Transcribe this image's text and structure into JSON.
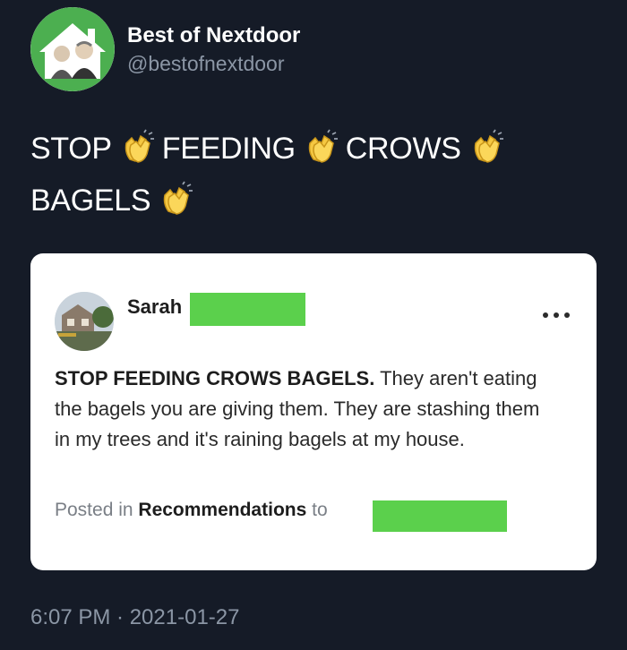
{
  "account": {
    "display_name": "Best of Nextdoor",
    "handle": "@bestofnextdoor",
    "avatar_icon": "house-avatar-icon"
  },
  "tweet": {
    "words": [
      "STOP",
      "FEEDING",
      "CROWS",
      "BAGELS"
    ],
    "emoji_icon": "clapping-hands-icon"
  },
  "embedded_post": {
    "author": "Sarah",
    "headline": "STOP FEEDING CROWS BAGELS.",
    "body": "They aren't eating the bagels you are giving them. They are stashing them in my trees and it's raining bagels at my house.",
    "posted_prefix": "Posted in",
    "category": "Recommendations",
    "posted_suffix": "to",
    "redaction_color": "#5bd04c"
  },
  "timestamp": "6:07 PM · 2021-01-27",
  "colors": {
    "background": "#151b27",
    "text_primary": "#ffffff",
    "text_secondary": "#8b96a5",
    "avatar_ring": "#4caf50"
  }
}
